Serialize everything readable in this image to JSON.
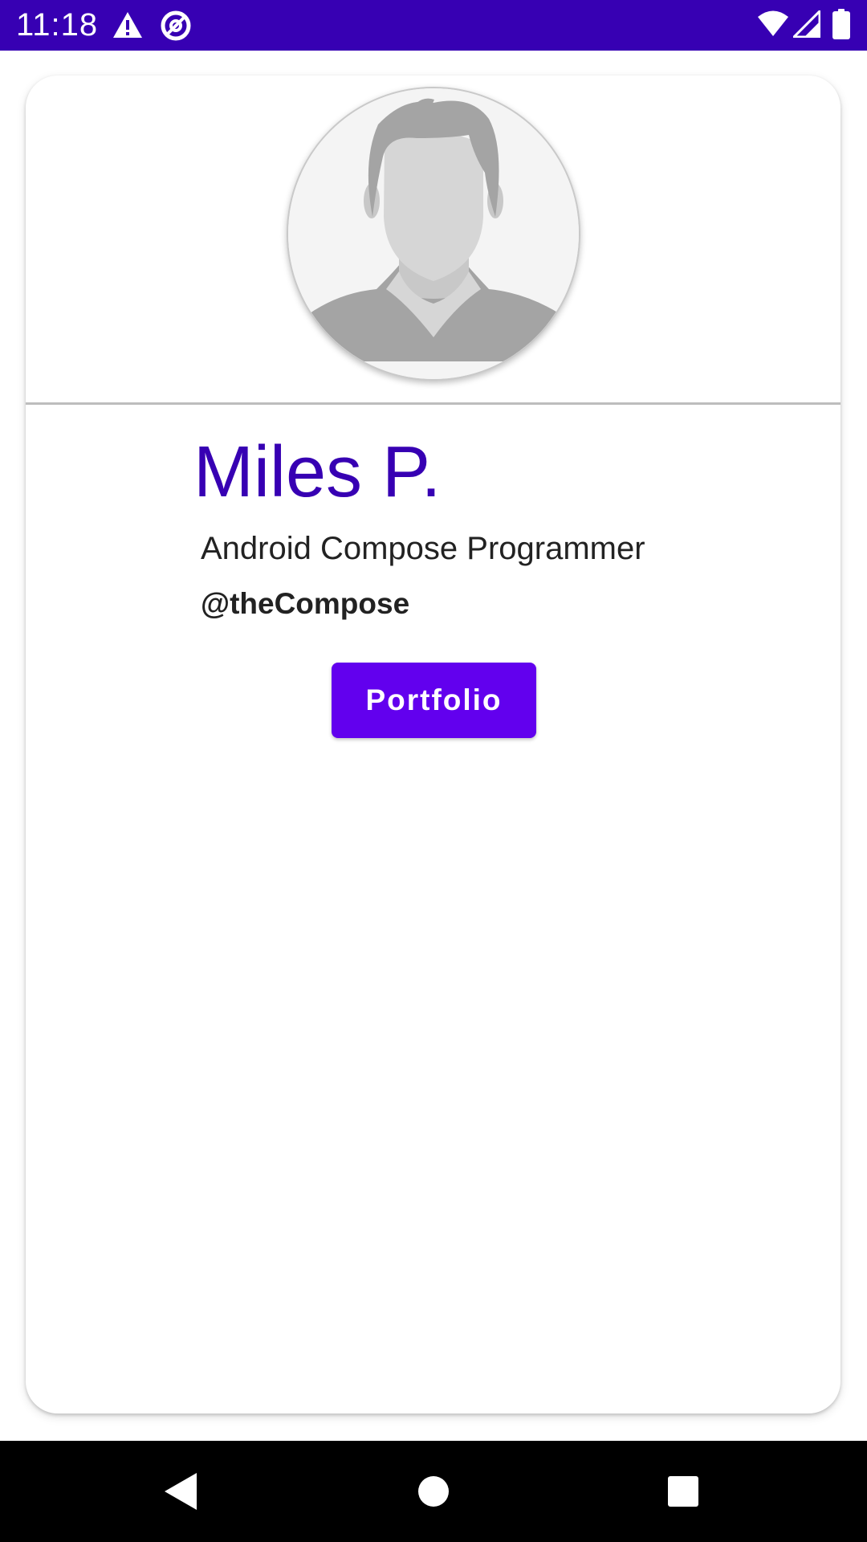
{
  "status_bar": {
    "time": "11:18",
    "background": "#3700b3",
    "icons": [
      "warning-icon",
      "sync-icon",
      "wifi-icon",
      "signal-icon",
      "battery-icon"
    ]
  },
  "profile": {
    "avatar_icon": "person-placeholder-icon",
    "name": "Miles P.",
    "title": "Android Compose Programmer",
    "handle": "@theCompose",
    "button_label": "Portfolio"
  },
  "colors": {
    "primary_dark": "#3700b3",
    "primary": "#6200ee"
  },
  "nav_bar": {
    "icons": [
      "back-icon",
      "home-icon",
      "recents-icon"
    ]
  }
}
